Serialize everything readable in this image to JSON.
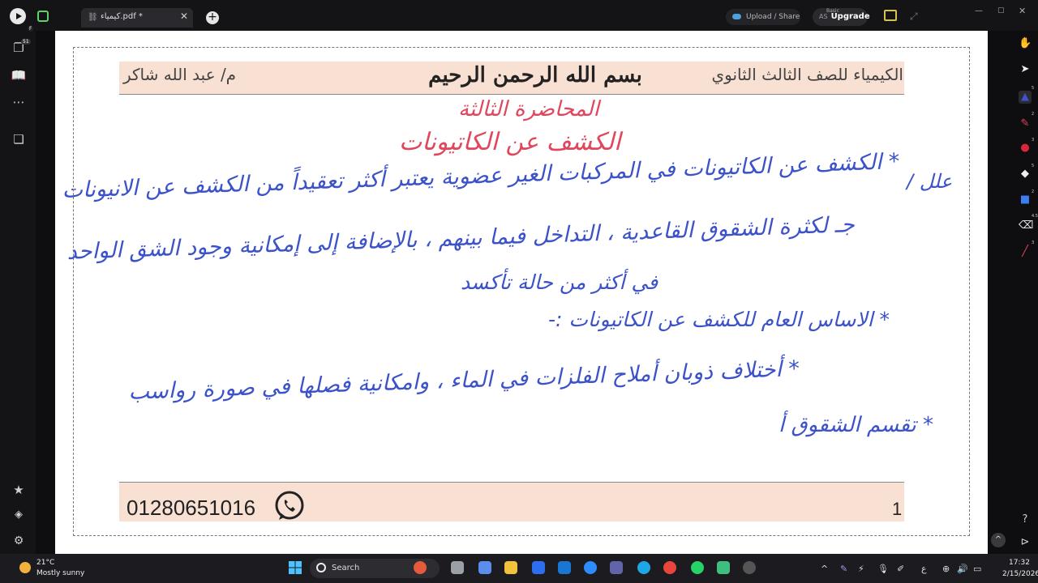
{
  "browser": {
    "tab_title": "كيمياء.pdf *",
    "tab_icon": "link-icon",
    "upload_label": "Upload / Share",
    "upgrade_label": "Upgrade",
    "upgrade_prefix": "AS",
    "plan_label": "Basic"
  },
  "left_sidebar": {
    "badge_count": "51",
    "badge_r": "F"
  },
  "right_toolbar": {
    "numbers": [
      "5",
      "2",
      "3",
      "5",
      "2",
      "4.5",
      "3"
    ],
    "icons": [
      "hand-icon",
      "pointer-icon",
      "shape-icon",
      "pen-icon",
      "marker-icon",
      "fill-icon",
      "rectangle-icon",
      "eraser-icon",
      "line-icon",
      "help-icon",
      "send-icon"
    ]
  },
  "document": {
    "header_right": "الكيمياء للصف الثالث الثانوي",
    "header_center": "بسم الله الرحمن الرحيم",
    "header_left": "م/ عبد الله شاكر",
    "lecture_title": "المحاضرة الثالثة",
    "lecture_subtitle": "الكشف عن الكاتيونات",
    "footer_page": "1",
    "footer_phone": "01280651016",
    "handwriting": {
      "line1": "* الكشف عن الكاتيونات في المركبات الغير عضوية يعتبر أكثر تعقيداً من الكشف عن الانيونات",
      "line2": "علل /",
      "line3": "جـ لكثرة الشقوق القاعدية ، التداخل فيما بينهم ، بالإضافة إلى إمكانية وجود الشق الواحد",
      "line4": "في أكثر من حالة تأكسد",
      "line5": "* الاساس العام للكشف عن الكاتيونات :-",
      "line6": "* أختلاف ذوبان أملاح الفلزات في الماء ، وامكانية فصلها في صورة رواسب",
      "line7": "* تقسم الشقوق أ"
    }
  },
  "taskbar": {
    "weather_temp": "21°C",
    "weather_desc": "Mostly sunny",
    "search_label": "Search",
    "clock_time": "17:32",
    "clock_date": "2/15/2026",
    "lang": "ع"
  },
  "colors": {
    "header_band": "#f8e0d3",
    "ink_red": "#e0465c",
    "ink_blue": "#3b52c8",
    "whatsapp": "#222222"
  }
}
